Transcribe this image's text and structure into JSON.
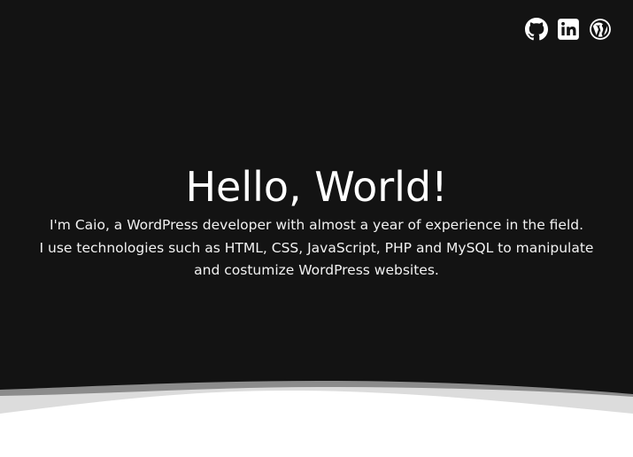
{
  "hero": {
    "title": "Hello, World!",
    "bio_lines": [
      "I'm Caio, a WordPress developer with almost a year of experience in the field.",
      "I use technologies such as HTML, CSS, JavaScript, PHP and MySQL to manipulate",
      "and costumize WordPress websites."
    ]
  },
  "social": {
    "icons": [
      "github-icon",
      "linkedin-icon",
      "wordpress-icon"
    ]
  },
  "colors": {
    "background": "#131313",
    "text": "#ffffff",
    "wave_dark": "#8c8c8c",
    "wave_light": "#dcdcdc",
    "page": "#ffffff"
  }
}
